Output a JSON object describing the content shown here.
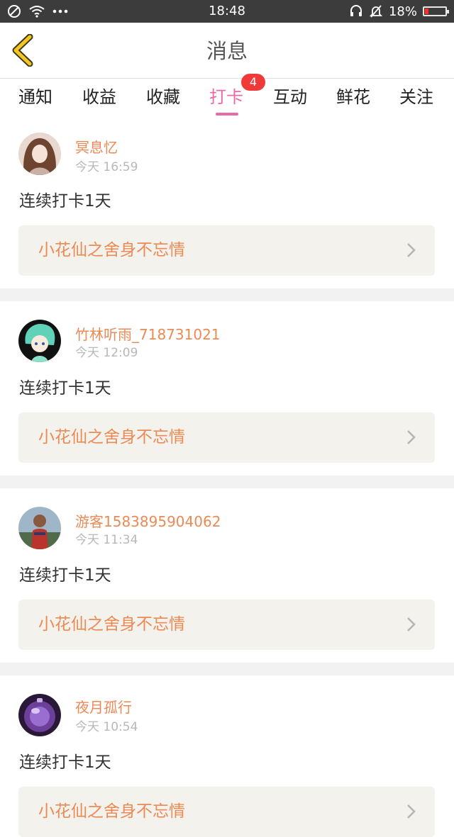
{
  "status_bar": {
    "time": "18:48",
    "battery": "18%",
    "battery_level": 0.18
  },
  "header": {
    "title": "消息"
  },
  "tabs": [
    {
      "label": "通知"
    },
    {
      "label": "收益"
    },
    {
      "label": "收藏"
    },
    {
      "label": "打卡",
      "active": true
    },
    {
      "label": "互动"
    },
    {
      "label": "鲜花"
    },
    {
      "label": "关注"
    }
  ],
  "badge": "4",
  "colors": {
    "accent": "#e86aa8",
    "name": "#ec8a55",
    "badge": "#f03a3a",
    "link_bg": "#f4f2ec"
  },
  "items": [
    {
      "name": "冥息忆",
      "time": "今天 16:59",
      "text": "连续打卡1天",
      "link": "小花仙之舍身不忘情"
    },
    {
      "name": "竹林听雨_718731021",
      "time": "今天 12:09",
      "text": "连续打卡1天",
      "link": "小花仙之舍身不忘情"
    },
    {
      "name": "游客1583895904062",
      "time": "今天 11:34",
      "text": "连续打卡1天",
      "link": "小花仙之舍身不忘情"
    },
    {
      "name": "夜月孤行",
      "time": "今天 10:54",
      "text": "连续打卡1天",
      "link": "小花仙之舍身不忘情"
    }
  ]
}
